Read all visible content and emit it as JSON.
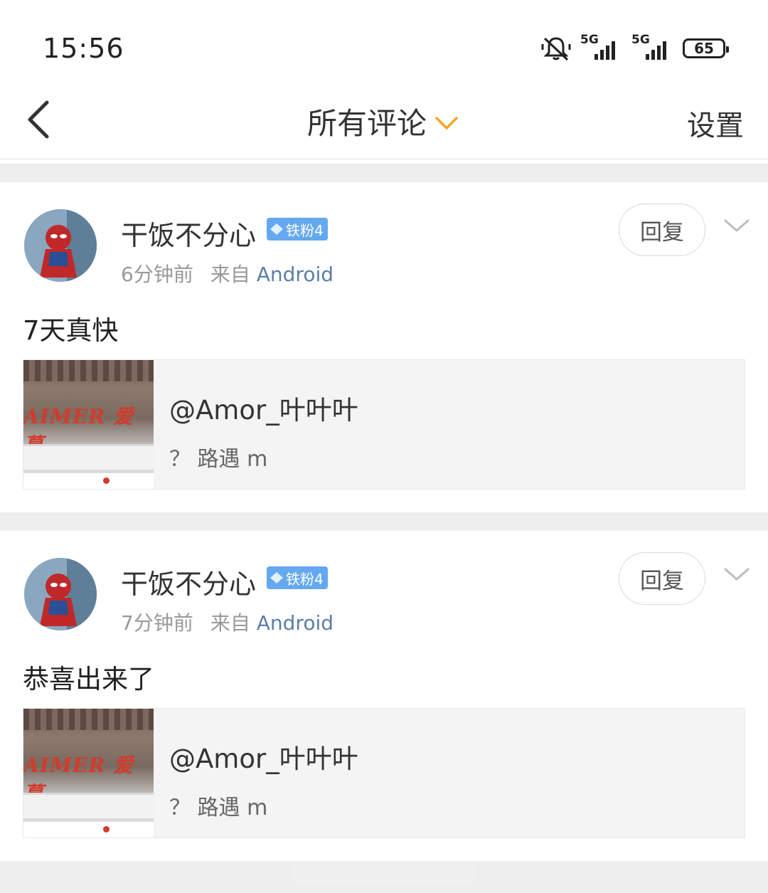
{
  "status_bar": {
    "time": "15:56",
    "sim1": "5G",
    "sim2": "5G",
    "battery": "65"
  },
  "nav": {
    "title": "所有评论",
    "settings_label": "设置",
    "accent_color": "#f5a623"
  },
  "comments": [
    {
      "username": "干饭不分心",
      "badge": "铁粉4",
      "time": "6分钟前",
      "source_prefix": "来自",
      "source": "Android",
      "text": "7天真快",
      "reply_label": "回复",
      "quote": {
        "author": "@Amor_叶叶叶",
        "snippet": "？ 路遇 m",
        "thumb_sign": "AIMER 爱慕"
      }
    },
    {
      "username": "干饭不分心",
      "badge": "铁粉4",
      "time": "7分钟前",
      "source_prefix": "来自",
      "source": "Android",
      "text": "恭喜出来了",
      "reply_label": "回复",
      "quote": {
        "author": "@Amor_叶叶叶",
        "snippet": "？ 路遇 m",
        "thumb_sign": "AIMER 爱慕"
      }
    }
  ]
}
